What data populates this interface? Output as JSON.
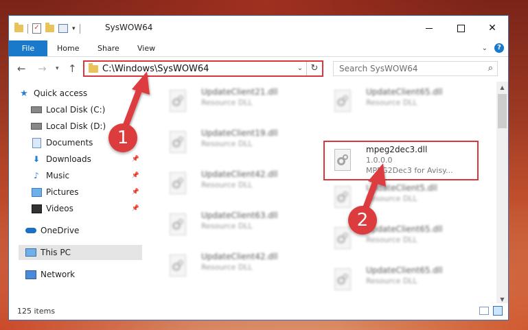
{
  "window": {
    "title": "SysWOW64"
  },
  "ribbon": {
    "tabs": [
      "File",
      "Home",
      "Share",
      "View"
    ],
    "help": "?"
  },
  "address": {
    "path": "C:\\Windows\\SysWOW64"
  },
  "search": {
    "placeholder": "Search SysWOW64"
  },
  "sidebar": {
    "items": [
      {
        "label": "Quick access",
        "icon": "star-icon"
      },
      {
        "label": "Local Disk (C:)",
        "icon": "disk-icon"
      },
      {
        "label": "Local Disk (D:)",
        "icon": "disk-icon"
      },
      {
        "label": "Documents",
        "icon": "document-icon"
      },
      {
        "label": "Downloads",
        "icon": "download-icon"
      },
      {
        "label": "Music",
        "icon": "music-icon"
      },
      {
        "label": "Pictures",
        "icon": "pictures-icon"
      },
      {
        "label": "Videos",
        "icon": "videos-icon"
      },
      {
        "label": "OneDrive",
        "icon": "cloud-icon"
      },
      {
        "label": "This PC",
        "icon": "computer-icon"
      },
      {
        "label": "Network",
        "icon": "network-icon"
      }
    ]
  },
  "files": {
    "left": [
      {
        "name": "UpdateClient21.dll",
        "type": "Resource DLL"
      },
      {
        "name": "UpdateClient19.dll",
        "type": "Resource DLL"
      },
      {
        "name": "UpdateClient42.dll",
        "type": "Resource DLL"
      },
      {
        "name": "UpdateClient63.dll",
        "type": "Resource DLL"
      },
      {
        "name": "UpdateClient42.dll",
        "type": "Resource DLL"
      }
    ],
    "right": [
      {
        "name": "UpdateClient65.dll",
        "type": "Resource DLL"
      },
      {
        "name": "UpdateClient5.dll",
        "type": "Resource DLL"
      },
      {
        "name": "UpdateClient65.dll",
        "type": "Resource DLL"
      },
      {
        "name": "UpdateClient65.dll",
        "type": "Resource DLL"
      }
    ],
    "highlighted": {
      "name": "mpeg2dec3.dll",
      "version": "1.0.0.0",
      "description": "MPEG2Dec3 for Avisy..."
    }
  },
  "status": {
    "count": "125 items"
  },
  "annotations": {
    "step1": "1",
    "step2": "2",
    "color": "#dd3c3f"
  }
}
